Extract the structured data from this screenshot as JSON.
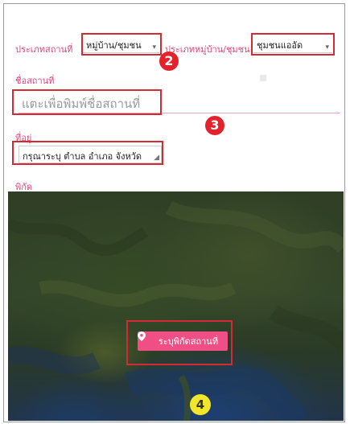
{
  "form": {
    "place_type_label": "ประเภทสถานที่",
    "place_type_value": "หมู่บ้าน/ชุมชน",
    "village_type_label": "ประเภทหมู่บ้าน/ชุมชน",
    "village_type_value": "ชุมชนแออัด",
    "place_name_label": "ชื่อสถานที่",
    "place_name_placeholder": "แตะเพื่อพิมพ์ชื่อสถานที่",
    "address_label": "ที่อยู่",
    "address_value": "กรุณาระบุ ตำบล อำเภอ จังหวัด",
    "coordinates_label": "พิกัด"
  },
  "map": {
    "set_location_button": "ระบุพิกัดสถานที่"
  },
  "annotations": {
    "badge_2": "2",
    "badge_3": "3",
    "badge_4": "4"
  },
  "colors": {
    "accent_pink": "#e0457b",
    "button_pink": "#f04f86",
    "highlight_red": "#d42a35",
    "badge_red": "#e4222b",
    "badge_yellow": "#f2e62a"
  }
}
